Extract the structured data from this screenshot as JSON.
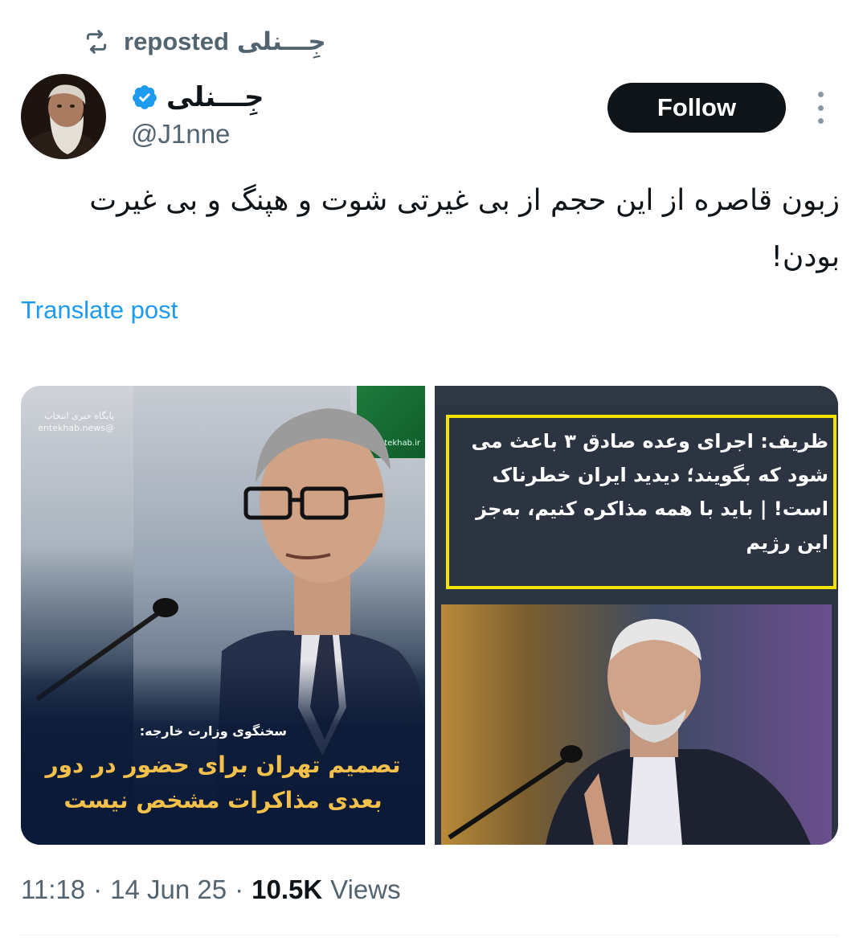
{
  "repost": {
    "icon": "repost-icon",
    "user_name": "جِـــنلی",
    "label": "reposted"
  },
  "author": {
    "display_name": "جِـــنلی",
    "handle": "@J1nne",
    "verified": true
  },
  "actions": {
    "follow_label": "Follow",
    "more_icon": "more-vertical-icon"
  },
  "tweet": {
    "text": "زبون قاصره از این حجم از بی غیرتی شوت و هپنگ و بی غیرت بودن!",
    "translate_label": "Translate post"
  },
  "media": {
    "left": {
      "watermark_left": "پایگاه خبری انتخاب @entekhab.news",
      "watermark_right": "Entekhab.ir",
      "label": "سخنگوی وزارت خارجه:",
      "headline": "تصمیم تهران برای حضور در دور بعدی مذاکرات مشخص نیست"
    },
    "right": {
      "quote": "ظریف: اجرای وعده صادق ۳ باعث می شود که بگویند؛ دیدید ایران خطرناک است! | باید با همه مذاکره کنیم، به‌جز این رژیم"
    }
  },
  "meta": {
    "time": "11:18",
    "separator": "·",
    "date": "14 Jun 25",
    "views_count": "10.5K",
    "views_label": "Views"
  },
  "colors": {
    "accent": "#1d9bf0",
    "quote_border": "#f2e200",
    "headline": "#f3c14b"
  }
}
